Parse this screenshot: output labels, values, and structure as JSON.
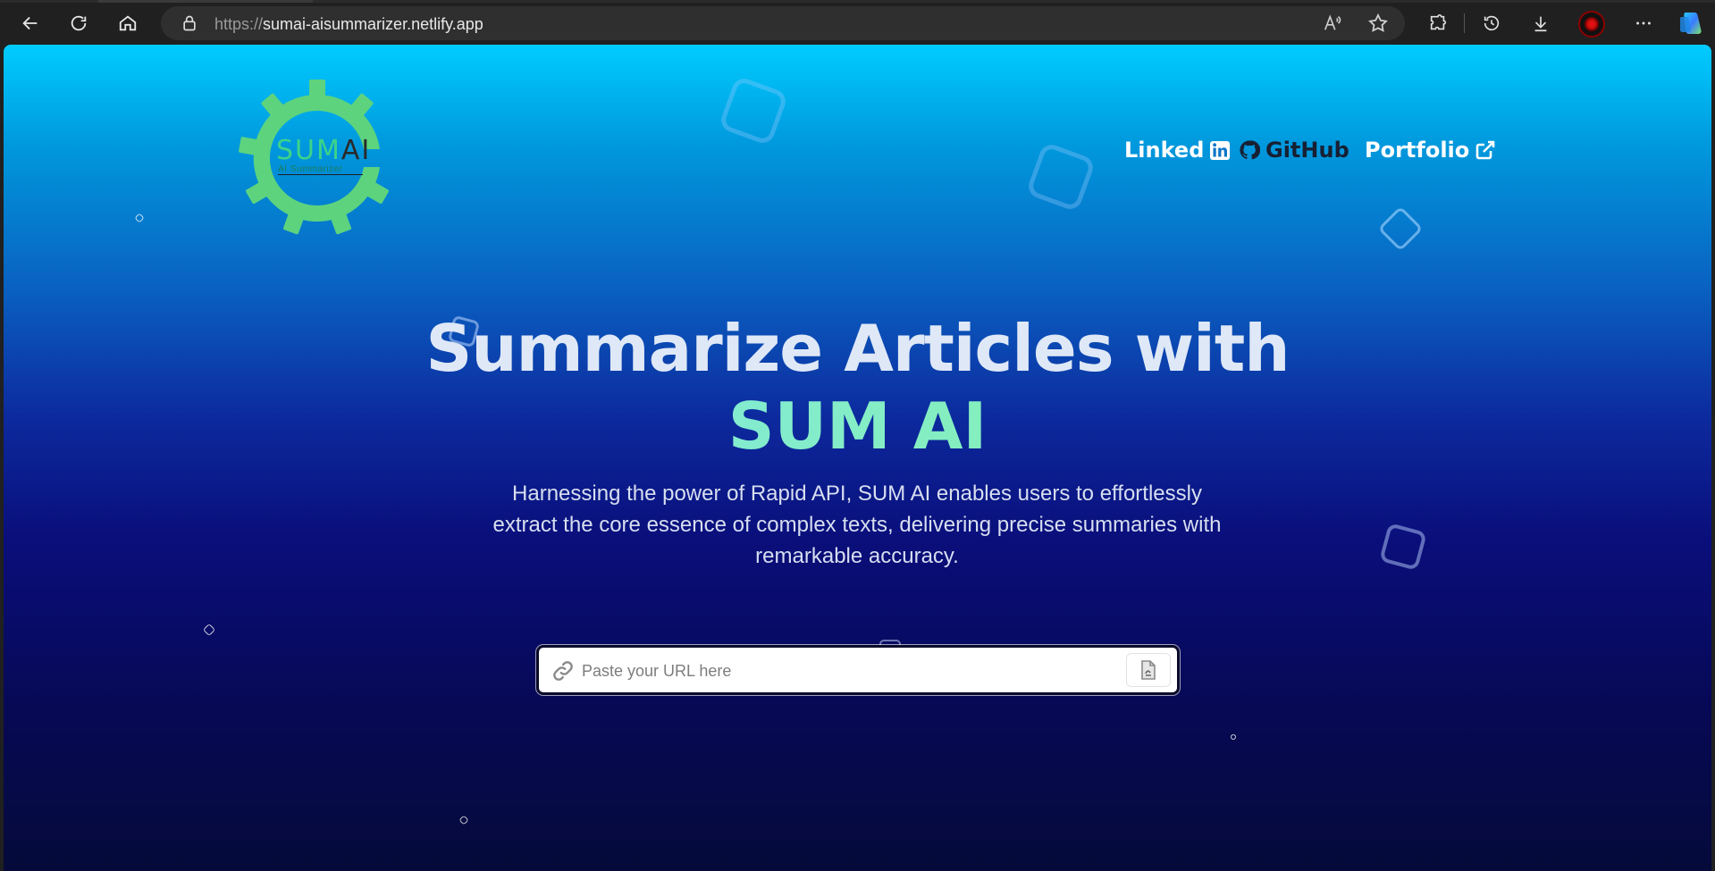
{
  "browser": {
    "url_protocol": "https://",
    "url_host": "sumai-aisummarizer.netlify.app"
  },
  "logo": {
    "sum": "SUM",
    "ai": "AI",
    "subtitle": "AI Summarizer"
  },
  "nav": {
    "linkedin_label": "Linked",
    "github_label": "GitHub",
    "portfolio_label": "Portfolio"
  },
  "hero": {
    "title_line1": "Summarize Articles with",
    "title_accent": "SUM AI",
    "description": "Harnessing the power of Rapid API, SUM AI enables users to effortlessly extract the core essence of complex texts, delivering precise summaries with remarkable accuracy."
  },
  "search": {
    "placeholder": "Paste your URL here",
    "value": ""
  },
  "colors": {
    "accent_green": "#3dd38a",
    "gradient_top": "#00ccff",
    "gradient_bottom": "#050a3a"
  }
}
